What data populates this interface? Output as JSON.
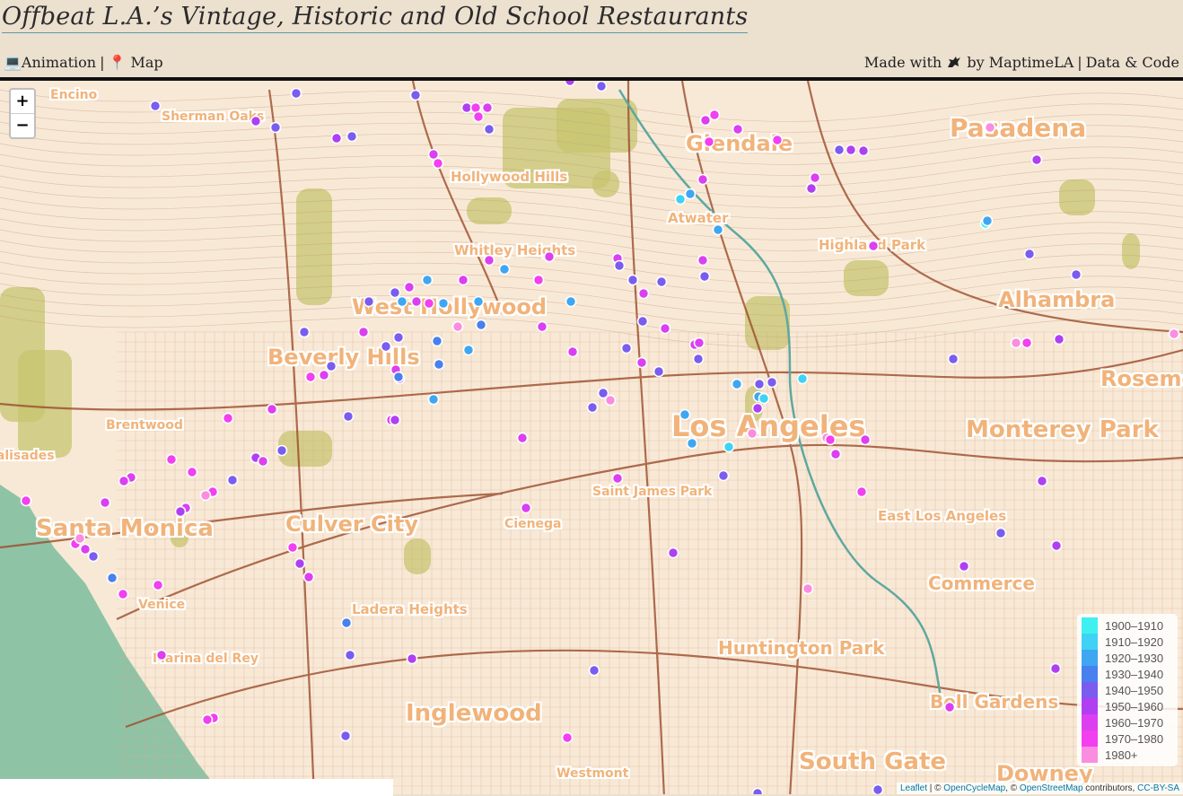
{
  "header": {
    "title": "Offbeat L.A.’s Vintage, Historic and Old School Restaurants",
    "nav_left": [
      {
        "icon": "monitor-icon",
        "glyph": "💻",
        "label": "Animation"
      },
      {
        "icon": "pin-icon",
        "glyph": "📍",
        "label": "Map"
      }
    ],
    "made_with": "Made with",
    "made_with_icon": "unicorn-icon",
    "by": "by MaptimeLA",
    "data_code": "Data & Code"
  },
  "map": {
    "zoom_in": "+",
    "zoom_out": "−",
    "places": [
      {
        "name": "Encino",
        "size": 14
      },
      {
        "name": "Sherman Oaks",
        "size": 14
      },
      {
        "name": "Glendale",
        "size": 24
      },
      {
        "name": "Pasadena",
        "size": 28
      },
      {
        "name": "Hollywood Hills",
        "size": 15
      },
      {
        "name": "Atwater",
        "size": 15
      },
      {
        "name": "Highland Park",
        "size": 15
      },
      {
        "name": "Whitley Heights",
        "size": 15
      },
      {
        "name": "Alhambra",
        "size": 24
      },
      {
        "name": "West Hollywood",
        "size": 24
      },
      {
        "name": "Beverly Hills",
        "size": 24
      },
      {
        "name": "Rosemead",
        "size": 24
      },
      {
        "name": "Los Angeles",
        "size": 32
      },
      {
        "name": "Monterey Park",
        "size": 26
      },
      {
        "name": "Brentwood",
        "size": 14
      },
      {
        "name": "Palisades",
        "size": 14
      },
      {
        "name": "Saint James Park",
        "size": 14
      },
      {
        "name": "Santa Monica",
        "size": 26
      },
      {
        "name": "Culver City",
        "size": 24
      },
      {
        "name": "Cienega",
        "size": 14
      },
      {
        "name": "East Los Angeles",
        "size": 15
      },
      {
        "name": "Commerce",
        "size": 20
      },
      {
        "name": "Venice",
        "size": 14
      },
      {
        "name": "Ladera Heights",
        "size": 15
      },
      {
        "name": "Huntington Park",
        "size": 20
      },
      {
        "name": "Marina del Rey",
        "size": 14
      },
      {
        "name": "Inglewood",
        "size": 26
      },
      {
        "name": "Bell Gardens",
        "size": 20
      },
      {
        "name": "South Gate",
        "size": 26
      },
      {
        "name": "Westmont",
        "size": 14
      },
      {
        "name": "Downey",
        "size": 24
      }
    ]
  },
  "legend": {
    "items": [
      {
        "label": "1900–1910",
        "color": "#3ff0f0"
      },
      {
        "label": "1910–1920",
        "color": "#3fd2f5"
      },
      {
        "label": "1920–1930",
        "color": "#3fa6f2"
      },
      {
        "label": "1930–1940",
        "color": "#4880ee"
      },
      {
        "label": "1940–1950",
        "color": "#7a5cef"
      },
      {
        "label": "1950–1960",
        "color": "#b03ff2"
      },
      {
        "label": "1960–1970",
        "color": "#dc3ff0"
      },
      {
        "label": "1970–1980",
        "color": "#f23ff0"
      },
      {
        "label": "1980+",
        "color": "#fb8de0"
      }
    ]
  },
  "attribution": {
    "leaflet": "Leaflet",
    "sep1": " | © ",
    "ocm": "OpenCycleMap",
    "sep2": ", © ",
    "osm": "OpenStreetMap",
    "contrib": " contributors, ",
    "license": "CC-BY-SA"
  }
}
